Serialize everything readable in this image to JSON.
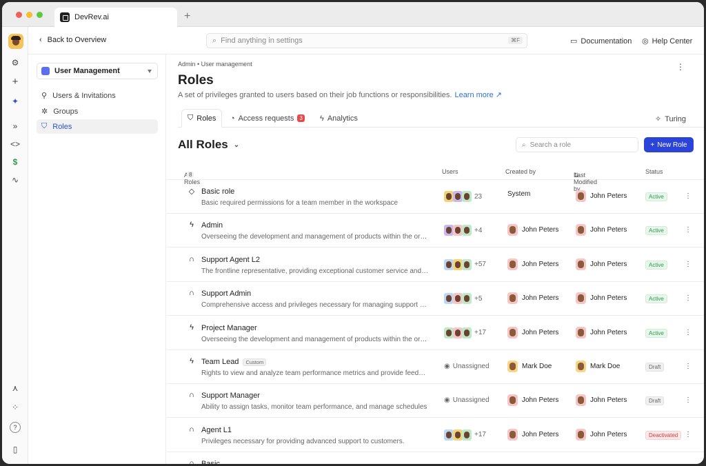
{
  "browser": {
    "tab_title": "DevRev.ai",
    "new_tab": "+"
  },
  "topbar": {
    "back_label": "Back to Overview",
    "search_placeholder": "Find anything in settings",
    "search_shortcut": "⌘F",
    "documentation": "Documentation",
    "help_center": "Help Center"
  },
  "sidebar": {
    "selector": "User Management",
    "items": [
      {
        "label": "Users & Invitations",
        "icon": "person-icon",
        "active": false
      },
      {
        "label": "Groups",
        "icon": "groups-icon",
        "active": false
      },
      {
        "label": "Roles",
        "icon": "shield-icon",
        "active": true
      }
    ]
  },
  "page": {
    "breadcrumb": "Admin • User management",
    "title": "Roles",
    "description": "A set of privileges granted to users based on their job functions or responsibilities.",
    "learn_more": "Learn more ↗",
    "tabs": [
      {
        "label": "Roles",
        "active": true
      },
      {
        "label": "Access requests",
        "badge": "3"
      },
      {
        "label": "Analytics"
      }
    ],
    "turing": "Turing",
    "list_title": "All Roles",
    "role_search_placeholder": "Search a role",
    "new_role": "New Role"
  },
  "table": {
    "headers": {
      "name": "All Roles",
      "name_count": "8",
      "users": "Users",
      "created_by": "Created by",
      "last_modified": "Last Modified by",
      "status": "Status"
    },
    "rows": [
      {
        "icon": "◇",
        "name": "Basic role",
        "tag": "",
        "desc": "Basic required permissions for a team member in the workspace",
        "users": "23",
        "created_by": "System",
        "modified_by": "John Peters",
        "status": "Active"
      },
      {
        "icon": "ϟ",
        "name": "Admin",
        "tag": "",
        "desc": "Overseeing the development and management of products within the organization",
        "users": "+4",
        "created_by": "John Peters",
        "modified_by": "John Peters",
        "status": "Active"
      },
      {
        "icon": "∩",
        "name": "Support Agent L2",
        "tag": "",
        "desc": "The frontline representative, providing exceptional customer service and support",
        "users": "+57",
        "created_by": "John Peters",
        "modified_by": "John Peters",
        "status": "Active"
      },
      {
        "icon": "∩",
        "name": "Support Admin",
        "tag": "",
        "desc": "Comprehensive access and privileges necessary for managing support operations",
        "users": "+5",
        "created_by": "John Peters",
        "modified_by": "John Peters",
        "status": "Active"
      },
      {
        "icon": "ϟ",
        "name": "Project Manager",
        "tag": "",
        "desc": "Overseeing the development and management of products within the organization",
        "users": "+17",
        "created_by": "John Peters",
        "modified_by": "John Peters",
        "status": "Active"
      },
      {
        "icon": "ϟ",
        "name": "Team Lead",
        "tag": "Custom",
        "desc": "Rights to view and analyze team performance metrics and provide feedback",
        "users": "Unassigned",
        "created_by": "Mark Doe",
        "modified_by": "Mark Doe",
        "status": "Draft"
      },
      {
        "icon": "∩",
        "name": "Support Manager",
        "tag": "",
        "desc": "Ability to assign tasks, monitor team performance, and manage schedules",
        "users": "Unassigned",
        "created_by": "John Peters",
        "modified_by": "John Peters",
        "status": "Draft"
      },
      {
        "icon": "∩",
        "name": "Agent L1",
        "tag": "",
        "desc": "Privileges necessary for providing advanced support to customers.",
        "users": "+17",
        "created_by": "John Peters",
        "modified_by": "John Peters",
        "status": "Deactivated"
      },
      {
        "icon": "∩",
        "name": "Basic",
        "tag": "",
        "desc": "",
        "users": "",
        "created_by": "",
        "modified_by": "",
        "status": ""
      }
    ]
  },
  "colors": {
    "accent": "#2b43d9",
    "active": "#2f9a4a",
    "deactivated": "#d33b3b"
  }
}
